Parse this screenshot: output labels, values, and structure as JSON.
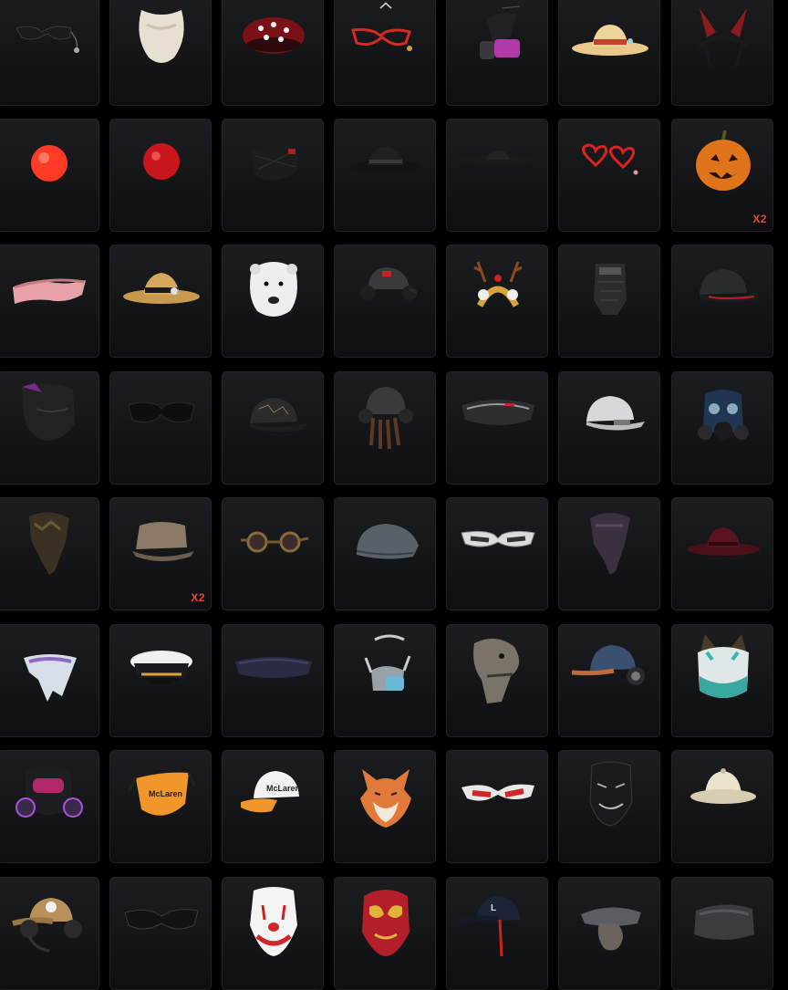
{
  "inventory": {
    "items": [
      {
        "icon": "black-glasses-chain-icon",
        "count": ""
      },
      {
        "icon": "white-beard-icon",
        "count": ""
      },
      {
        "icon": "red-flower-beret-icon",
        "count": ""
      },
      {
        "icon": "red-glasses-icon",
        "count": ""
      },
      {
        "icon": "pink-gas-mask-icon",
        "count": ""
      },
      {
        "icon": "straw-sun-hat-icon",
        "count": ""
      },
      {
        "icon": "red-bunny-ears-headband-icon",
        "count": ""
      },
      {
        "icon": "red-clown-nose-icon",
        "count": ""
      },
      {
        "icon": "dark-red-clown-nose-icon",
        "count": ""
      },
      {
        "icon": "black-quilted-face-mask-icon",
        "count": ""
      },
      {
        "icon": "black-fedora-icon",
        "count": ""
      },
      {
        "icon": "black-wide-brim-hat-icon",
        "count": ""
      },
      {
        "icon": "red-heart-glasses-icon",
        "count": ""
      },
      {
        "icon": "pumpkin-head-icon",
        "count": "X2"
      },
      {
        "icon": "pink-sleep-mask-icon",
        "count": ""
      },
      {
        "icon": "straw-hat-ribbon-icon",
        "count": ""
      },
      {
        "icon": "polar-bear-mask-icon",
        "count": ""
      },
      {
        "icon": "gray-cap-headphones-icon",
        "count": ""
      },
      {
        "icon": "reindeer-antlers-headband-icon",
        "count": ""
      },
      {
        "icon": "metal-face-guard-icon",
        "count": ""
      },
      {
        "icon": "dark-baseball-cap-icon",
        "count": ""
      },
      {
        "icon": "black-balaclava-mask-icon",
        "count": ""
      },
      {
        "icon": "black-sunglasses-icon",
        "count": ""
      },
      {
        "icon": "cracked-black-cap-icon",
        "count": ""
      },
      {
        "icon": "dreadlocks-helmet-icon",
        "count": ""
      },
      {
        "icon": "chrome-visor-glasses-icon",
        "count": ""
      },
      {
        "icon": "white-cap-icon",
        "count": ""
      },
      {
        "icon": "blue-gas-mask-icon",
        "count": ""
      },
      {
        "icon": "camo-bandana-icon",
        "count": ""
      },
      {
        "icon": "worn-cadet-cap-icon",
        "count": "X2"
      },
      {
        "icon": "steampunk-goggles-icon",
        "count": ""
      },
      {
        "icon": "gray-flat-cap-icon",
        "count": ""
      },
      {
        "icon": "white-sport-sunglasses-icon",
        "count": ""
      },
      {
        "icon": "purple-bandana-icon",
        "count": ""
      },
      {
        "icon": "maroon-fedora-icon",
        "count": ""
      },
      {
        "icon": "white-scarf-icon",
        "count": ""
      },
      {
        "icon": "captain-hat-icon",
        "count": ""
      },
      {
        "icon": "navy-visor-icon",
        "count": ""
      },
      {
        "icon": "clear-respirator-icon",
        "count": ""
      },
      {
        "icon": "dinosaur-head-icon",
        "count": ""
      },
      {
        "icon": "denim-cap-headphones-icon",
        "count": ""
      },
      {
        "icon": "teal-cat-ear-wig-icon",
        "count": ""
      },
      {
        "icon": "neon-gas-mask-icon",
        "count": ""
      },
      {
        "icon": "mclaren-orange-face-mask-icon",
        "count": ""
      },
      {
        "icon": "mclaren-cap-icon",
        "count": ""
      },
      {
        "icon": "fox-head-icon",
        "count": ""
      },
      {
        "icon": "red-sport-sunglasses-icon",
        "count": ""
      },
      {
        "icon": "black-smile-mask-icon",
        "count": ""
      },
      {
        "icon": "pith-helmet-icon",
        "count": ""
      },
      {
        "icon": "tan-cap-headset-icon",
        "count": ""
      },
      {
        "icon": "black-wrap-sunglasses-icon",
        "count": ""
      },
      {
        "icon": "clown-mask-icon",
        "count": ""
      },
      {
        "icon": "luchador-mask-icon",
        "count": ""
      },
      {
        "icon": "navy-cap-red-strap-icon",
        "count": ""
      },
      {
        "icon": "gray-cap-hair-bun-icon",
        "count": ""
      },
      {
        "icon": "fur-ushanka-hat-icon",
        "count": ""
      }
    ]
  },
  "colors": {
    "count_badge": "#e2493a",
    "tile_background": "#16171a",
    "page_background": "#000000"
  }
}
